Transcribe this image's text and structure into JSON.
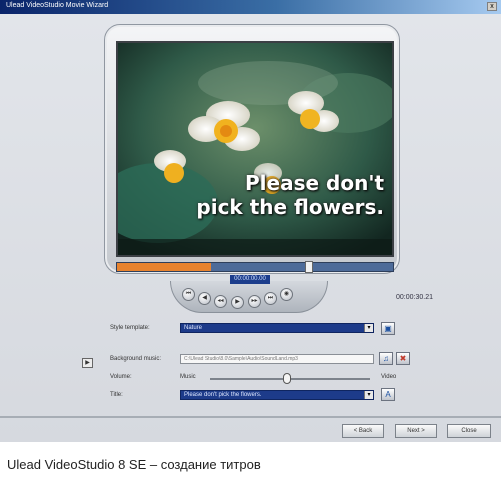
{
  "window": {
    "title": "Ulead VideoStudio Movie Wizard",
    "close_glyph": "x"
  },
  "preview": {
    "caption_line1": "Please don't",
    "caption_line2": "pick the flowers.",
    "timecode": "00:00:00.00",
    "duration": "00:00:30.21",
    "scrub_progress": 0.34,
    "trim_end_progress": 0.68,
    "controls": [
      {
        "name": "home-icon",
        "glyph": "⏮"
      },
      {
        "name": "prev-frame-icon",
        "glyph": "◀"
      },
      {
        "name": "rewind-icon",
        "glyph": "◂◂"
      },
      {
        "name": "play-icon",
        "glyph": "▶"
      },
      {
        "name": "forward-icon",
        "glyph": "▸▸"
      },
      {
        "name": "end-icon",
        "glyph": "⏭"
      },
      {
        "name": "volume-icon",
        "glyph": "◉"
      }
    ]
  },
  "options": {
    "style_template_label": "Style template:",
    "style_template_value": "Nature",
    "background_music_label": "Background music:",
    "background_music_value": "C:\\Ulead Studio\\8.0\\Sample\\Audio\\SoundLand.mp3",
    "volume_label": "Volume:",
    "volume_left": "Music",
    "volume_right": "Video",
    "volume_level": 0.48,
    "title_label": "Title:",
    "title_value": "Please don't pick the flowers.",
    "combo_arrow": "▾"
  },
  "buttons": {
    "back": "< Back",
    "next": "Next >",
    "close": "Close"
  },
  "figure_caption": "Ulead VideoStudio 8 SE – создание титров"
}
